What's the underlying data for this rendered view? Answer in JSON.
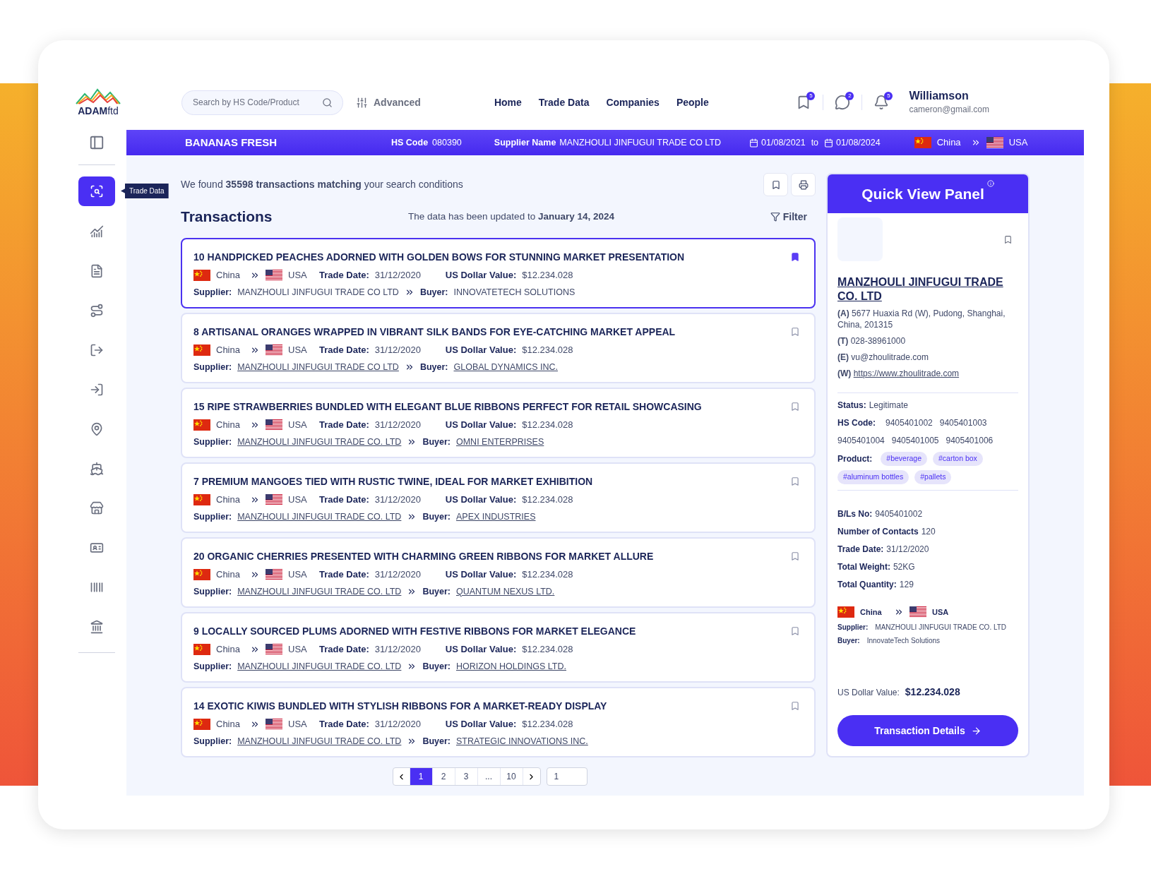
{
  "logo": {
    "name": "ADAM",
    "suffix": "ftd"
  },
  "search": {
    "placeholder": "Search by HS Code/Product"
  },
  "advanced": "Advanced",
  "nav": [
    "Home",
    "Trade Data",
    "Companies",
    "People"
  ],
  "header_icons": [
    {
      "kind": "bookmark",
      "count": "5"
    },
    {
      "kind": "chat",
      "count": "2"
    },
    {
      "kind": "bell",
      "count": "5"
    }
  ],
  "user": {
    "name": "Williamson",
    "email": "cameron@gmail.com"
  },
  "sidebar": {
    "items": [
      {
        "kind": "trade-data",
        "selected": true,
        "tooltip": "Trade Data"
      },
      {
        "kind": "chart",
        "selected": false
      },
      {
        "kind": "invoice",
        "selected": false
      },
      {
        "kind": "route",
        "selected": false
      },
      {
        "kind": "export",
        "selected": false
      },
      {
        "kind": "import",
        "selected": false
      },
      {
        "kind": "location",
        "selected": false
      },
      {
        "kind": "ship",
        "selected": false
      },
      {
        "kind": "store",
        "selected": false
      },
      {
        "kind": "contact",
        "selected": false
      },
      {
        "kind": "barcode",
        "selected": false
      },
      {
        "kind": "bank",
        "selected": false
      }
    ]
  },
  "banner": {
    "product": "BANANAS FRESH",
    "hs_code_label": "HS Code",
    "hs_code": "080390",
    "supplier_label": "Supplier Name",
    "supplier": "MANZHOULI JINFUGUI TRADE CO LTD",
    "date_from": "01/08/2021",
    "date_sep": "to",
    "date_to": "01/08/2024",
    "route": {
      "origin": {
        "name": "China",
        "kind": "cn"
      },
      "destination": {
        "name": "USA",
        "kind": "us"
      }
    }
  },
  "summary": "We found **35598 transactions matching** your search conditions",
  "transactions": {
    "title": "Transactions",
    "updated": "The data has been updated to **January 14, 2024**",
    "filter": "Filter",
    "items": [
      {
        "title": "10 HANDPICKED PEACHES ADORNED WITH GOLDEN BOWS FOR STUNNING MARKET PRESENTATION",
        "route": {
          "origin": {
            "name": "China",
            "kind": "cn"
          },
          "destination": {
            "name": "USA",
            "kind": "us"
          }
        },
        "trade_date_label": "Trade Date:",
        "trade_date": "31/12/2020",
        "value_label": "US Dollar Value:",
        "value": "$12.234.028",
        "supplier_label": "Supplier:",
        "supplier": "MANZHOULI JINFUGUI TRADE CO LTD",
        "buyer_label": "Buyer:",
        "buyer": "INNOVATETECH SOLUTIONS",
        "selected": true,
        "bookmarked": true
      },
      {
        "title": "8 ARTISANAL ORANGES WRAPPED IN VIBRANT SILK BANDS FOR EYE-CATCHING MARKET APPEAL",
        "route": {
          "origin": {
            "name": "China",
            "kind": "cn"
          },
          "destination": {
            "name": "USA",
            "kind": "us"
          }
        },
        "trade_date_label": "Trade Date:",
        "trade_date": "31/12/2020",
        "value_label": "US Dollar Value:",
        "value": "$12.234.028",
        "supplier_label": "Supplier:",
        "supplier": "MANZHOULI JINFUGUI TRADE CO LTD",
        "buyer_label": "Buyer:",
        "buyer": "GLOBAL DYNAMICS INC.",
        "selected": false,
        "bookmarked": false
      },
      {
        "title": "15 RIPE STRAWBERRIES BUNDLED WITH ELEGANT BLUE RIBBONS PERFECT FOR RETAIL SHOWCASING",
        "route": {
          "origin": {
            "name": "China",
            "kind": "cn"
          },
          "destination": {
            "name": "USA",
            "kind": "us"
          }
        },
        "trade_date_label": "Trade Date:",
        "trade_date": "31/12/2020",
        "value_label": "US Dollar Value:",
        "value": "$12.234.028",
        "supplier_label": "Supplier:",
        "supplier": "MANZHOULI JINFUGUI TRADE CO. LTD",
        "buyer_label": "Buyer:",
        "buyer": "OMNI ENTERPRISES",
        "selected": false,
        "bookmarked": false
      },
      {
        "title": "7 PREMIUM MANGOES TIED WITH RUSTIC TWINE, IDEAL FOR MARKET EXHIBITION",
        "route": {
          "origin": {
            "name": "China",
            "kind": "cn"
          },
          "destination": {
            "name": "USA",
            "kind": "us"
          }
        },
        "trade_date_label": "Trade Date:",
        "trade_date": "31/12/2020",
        "value_label": "US Dollar Value:",
        "value": "$12.234.028",
        "supplier_label": "Supplier:",
        "supplier": "MANZHOULI JINFUGUI TRADE CO. LTD",
        "buyer_label": "Buyer:",
        "buyer": "APEX INDUSTRIES",
        "selected": false,
        "bookmarked": false
      },
      {
        "title": "20 ORGANIC CHERRIES PRESENTED WITH CHARMING GREEN RIBBONS FOR MARKET ALLURE",
        "route": {
          "origin": {
            "name": "China",
            "kind": "cn"
          },
          "destination": {
            "name": "USA",
            "kind": "us"
          }
        },
        "trade_date_label": "Trade Date:",
        "trade_date": "31/12/2020",
        "value_label": "US Dollar Value:",
        "value": "$12.234.028",
        "supplier_label": "Supplier:",
        "supplier": "MANZHOULI JINFUGUI TRADE CO. LTD",
        "buyer_label": "Buyer:",
        "buyer": "QUANTUM NEXUS LTD.",
        "selected": false,
        "bookmarked": false
      },
      {
        "title": "9 LOCALLY SOURCED PLUMS ADORNED WITH FESTIVE RIBBONS FOR MARKET ELEGANCE",
        "route": {
          "origin": {
            "name": "China",
            "kind": "cn"
          },
          "destination": {
            "name": "USA",
            "kind": "us"
          }
        },
        "trade_date_label": "Trade Date:",
        "trade_date": "31/12/2020",
        "value_label": "US Dollar Value:",
        "value": "$12.234.028",
        "supplier_label": "Supplier:",
        "supplier": "MANZHOULI JINFUGUI TRADE CO. LTD",
        "buyer_label": "Buyer:",
        "buyer": "HORIZON HOLDINGS LTD.",
        "selected": false,
        "bookmarked": false
      },
      {
        "title": "14 EXOTIC KIWIS BUNDLED WITH STYLISH RIBBONS FOR A MARKET-READY DISPLAY",
        "route": {
          "origin": {
            "name": "China",
            "kind": "cn"
          },
          "destination": {
            "name": "USA",
            "kind": "us"
          }
        },
        "trade_date_label": "Trade Date:",
        "trade_date": "31/12/2020",
        "value_label": "US Dollar Value:",
        "value": "$12.234.028",
        "supplier_label": "Supplier:",
        "supplier": "MANZHOULI JINFUGUI TRADE CO. LTD",
        "buyer_label": "Buyer:",
        "buyer": "STRATEGIC INNOVATIONS INC.",
        "selected": false,
        "bookmarked": false
      }
    ]
  },
  "pagination": {
    "pages": [
      {
        "label": "1",
        "selected": true
      },
      {
        "label": "2",
        "selected": false
      },
      {
        "label": "3",
        "selected": false
      },
      {
        "label": "...",
        "selected": false
      },
      {
        "label": "10",
        "selected": false
      }
    ],
    "jump_value": "1"
  },
  "quick_view": {
    "title": "Quick View Panel",
    "bookmarked": false,
    "company": "MANZHOULI JINFUGUI TRADE CO. LTD",
    "contacts": [
      {
        "label": "(A)",
        "value": "5677 Huaxia Rd (W), Pudong, Shanghai, China, 201315",
        "kind": "text"
      },
      {
        "label": "(T)",
        "value": "028-38961000",
        "kind": "text"
      },
      {
        "label": "(E)",
        "value": "vu@zhoulitrade.com",
        "kind": "text"
      },
      {
        "label": "(W)",
        "value": "https://www.zhoulitrade.com",
        "kind": "link"
      }
    ],
    "status_label": "Status:",
    "status": "Legitimate",
    "hs_code_label": "HS Code:",
    "hs_codes": [
      "9405401002",
      "9405401003",
      "9405401004",
      "9405401005",
      "9405401006"
    ],
    "product_label": "Product:",
    "tags": [
      "#beverage",
      "#carton box",
      "#aluminum bottles",
      "#pallets"
    ],
    "details": [
      {
        "label": "B/Ls No:",
        "value": "9405401002"
      },
      {
        "label": "Number of Contacts",
        "value": "120"
      },
      {
        "label": "Trade Date:",
        "value": "31/12/2020"
      },
      {
        "label": "Total Weight:",
        "value": "52KG"
      },
      {
        "label": "Total Quantity:",
        "value": "129"
      }
    ],
    "route": {
      "origin": {
        "name": "China",
        "kind": "cn"
      },
      "destination": {
        "name": "USA",
        "kind": "us"
      }
    },
    "supplier_label": "Supplier:",
    "supplier": "MANZHOULI JINFUGUI TRADE CO. LTD",
    "buyer_label": "Buyer:",
    "buyer": "InnovateTech Solutions",
    "value_label": "US Dollar Value:",
    "value": "$12.234.028",
    "button": "Transaction Details"
  }
}
